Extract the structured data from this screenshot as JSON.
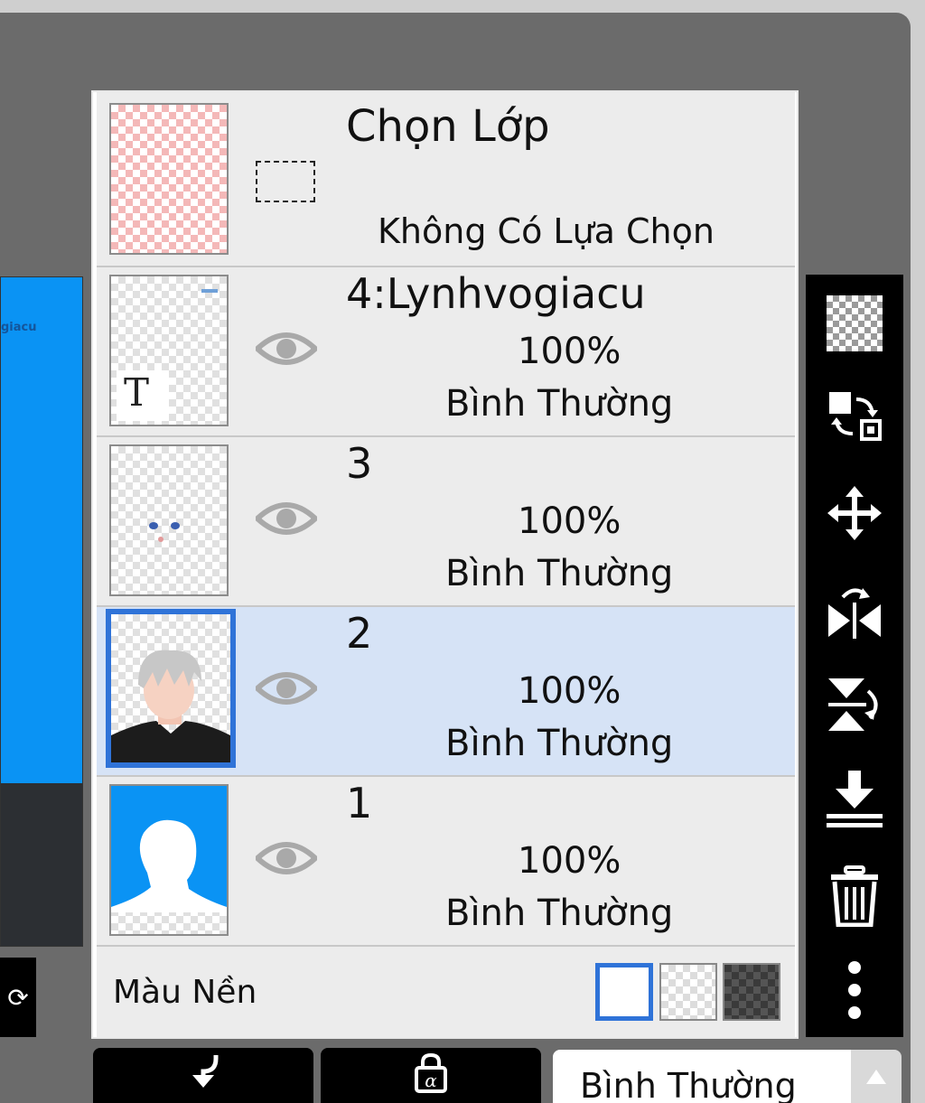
{
  "selection_layer": {
    "title": "Chọn Lớp",
    "subtitle": "Không Có Lựa Chọn"
  },
  "layers": [
    {
      "name": "4:Lynhvogiacu",
      "opacity": "100%",
      "blend": "Bình Thường",
      "thumb_badge": "T"
    },
    {
      "name": "3",
      "opacity": "100%",
      "blend": "Bình Thường"
    },
    {
      "name": "2",
      "opacity": "100%",
      "blend": "Bình Thường",
      "selected": true
    },
    {
      "name": "1",
      "opacity": "100%",
      "blend": "Bình Thường"
    }
  ],
  "background": {
    "label": "Màu Nền"
  },
  "canvas_preview": {
    "text": "giacu"
  },
  "blend_mode_select": {
    "value": "Bình Thường"
  },
  "toolbar_icons": [
    "checkerboard-icon",
    "swap-layers-icon",
    "move-icon",
    "flip-horizontal-icon",
    "flip-vertical-icon",
    "merge-down-icon",
    "trash-icon",
    "more-icon"
  ],
  "colors": {
    "accent": "#2f73d8",
    "selected_row": "#d6e3f6",
    "canvas_blue": "#0a93f4"
  }
}
